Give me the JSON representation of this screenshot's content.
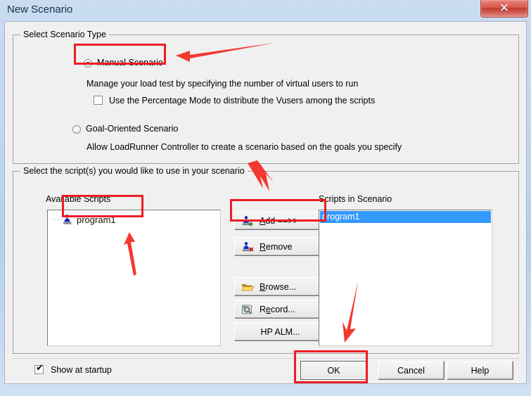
{
  "window": {
    "title": "New Scenario",
    "close_label": "✕",
    "close_icon": "close-icon"
  },
  "scenario_type": {
    "group_label": "Select Scenario Type",
    "manual": {
      "label": "Manual Scenario",
      "selected": true,
      "description": "Manage your load test by specifying the number of virtual users to run"
    },
    "percentage_mode": {
      "label": "Use the Percentage Mode to distribute the Vusers among the scripts",
      "checked": false
    },
    "goal_oriented": {
      "label": "Goal-Oriented Scenario",
      "selected": false,
      "description": "Allow LoadRunner Controller to create a scenario based on the goals you specify"
    }
  },
  "scripts": {
    "group_label": "Select the script(s) you would like to use in your scenario",
    "available_label": "Available Scripts",
    "available_items": [
      {
        "name": "program1",
        "icon": "vuser-script-icon"
      }
    ],
    "scenario_label": "Scripts in Scenario",
    "scenario_items": [
      {
        "name": "program1",
        "selected": true
      }
    ],
    "buttons": {
      "add": {
        "label": "Add ==>>",
        "accel": "A",
        "icon": "add-script-icon"
      },
      "remove": {
        "label": "Remove",
        "accel": "R",
        "icon": "remove-script-icon"
      },
      "browse": {
        "label": "Browse...",
        "accel": "B",
        "icon": "folder-open-icon"
      },
      "record": {
        "label": "Record...",
        "accel": "e",
        "icon": "record-icon"
      },
      "hp_alm": {
        "label": "HP ALM...",
        "icon": "hp-alm-icon"
      }
    }
  },
  "footer": {
    "show_at_startup": {
      "label": "Show at startup",
      "checked": true,
      "tick": "✔"
    },
    "ok": "OK",
    "cancel": "Cancel",
    "help": "Help"
  },
  "annotations": {
    "color": "#ee1c25",
    "highlights": [
      "manual-scenario-radio",
      "available-script-program1",
      "add-button",
      "ok-button"
    ],
    "arrows": [
      "arrow-to-manual-scenario",
      "arrow-to-program1",
      "arrow-to-add-button",
      "arrow-to-ok-button"
    ]
  }
}
